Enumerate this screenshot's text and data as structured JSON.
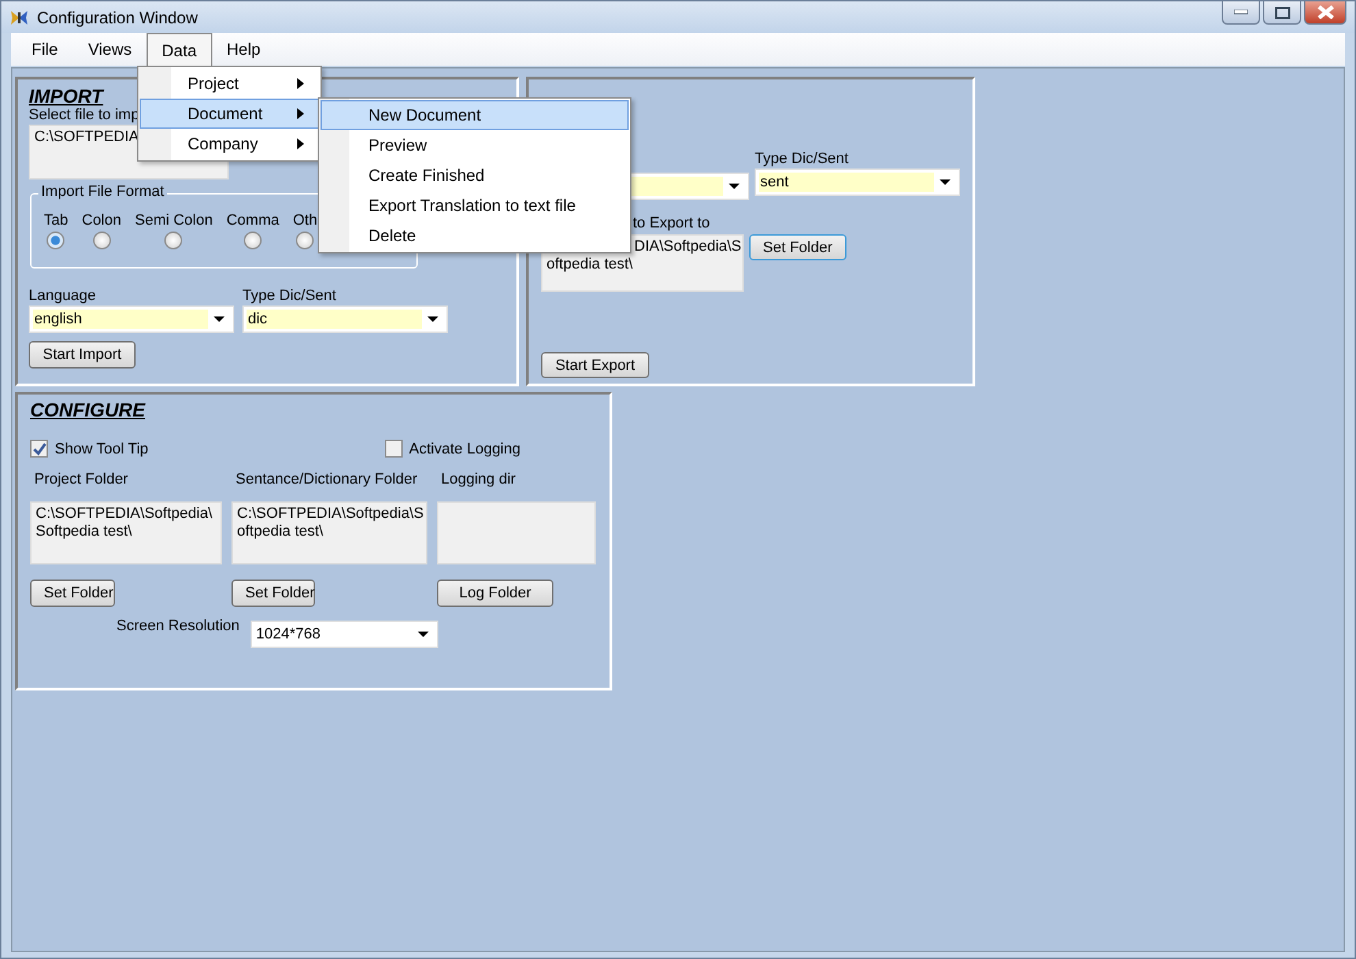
{
  "window": {
    "title": "Configuration Window"
  },
  "menu_bar": [
    {
      "label": "File",
      "selected": false
    },
    {
      "label": "Views",
      "selected": false
    },
    {
      "label": "Data",
      "selected": true
    },
    {
      "label": "Help",
      "selected": false
    }
  ],
  "data_menu": [
    {
      "label": "Project",
      "selected": false
    },
    {
      "label": "Document",
      "selected": true
    },
    {
      "label": "Company",
      "selected": false
    }
  ],
  "document_submenu": [
    {
      "label": "New Document",
      "selected": true
    },
    {
      "label": "Preview",
      "selected": false
    },
    {
      "label": "Create Finished",
      "selected": false
    },
    {
      "label": "Export Translation to text file",
      "selected": false
    },
    {
      "label": "Delete",
      "selected": false
    }
  ],
  "import": {
    "title": "IMPORT",
    "file_label": "Select file to imp",
    "file_value": "C:\\SOFTPEDIA",
    "format": {
      "legend": "Import File Format",
      "options": [
        {
          "label": "Tab",
          "selected": true
        },
        {
          "label": "Colon",
          "selected": false
        },
        {
          "label": "Semi Colon",
          "selected": false
        },
        {
          "label": "Comma",
          "selected": false
        },
        {
          "label": "Oth",
          "selected": false
        }
      ]
    },
    "language": {
      "label": "Language",
      "value": "english"
    },
    "type": {
      "label": "Type Dic/Sent",
      "value": "dic"
    },
    "start_button": "Start Import"
  },
  "export": {
    "type": {
      "label": "Type Dic/Sent",
      "value": "sent"
    },
    "folder_label": "to Export to",
    "folder_lines": [
      "DIA\\Softpedia\\S",
      "oftpedia test\\"
    ],
    "set_folder_button": "Set Folder",
    "start_button": "Start Export"
  },
  "configure": {
    "title": "CONFIGURE",
    "show_tool_tip": {
      "label": "Show Tool Tip",
      "checked": true
    },
    "activate_logging": {
      "label": "Activate Logging",
      "checked": false
    },
    "folders": [
      {
        "label": "Project Folder",
        "value_lines": [
          "C:\\SOFTPEDIA\\Softpedia\\",
          "Softpedia test\\"
        ],
        "button": "Set Folder"
      },
      {
        "label": "Sentance/Dictionary Folder",
        "value_lines": [
          "C:\\SOFTPEDIA\\Softpedia\\S",
          "oftpedia test\\"
        ],
        "button": "Set Folder"
      },
      {
        "label": "Logging dir",
        "button": "Log Folder"
      }
    ],
    "resolution": {
      "label": "Screen Resolution",
      "value": "1024*768"
    }
  }
}
